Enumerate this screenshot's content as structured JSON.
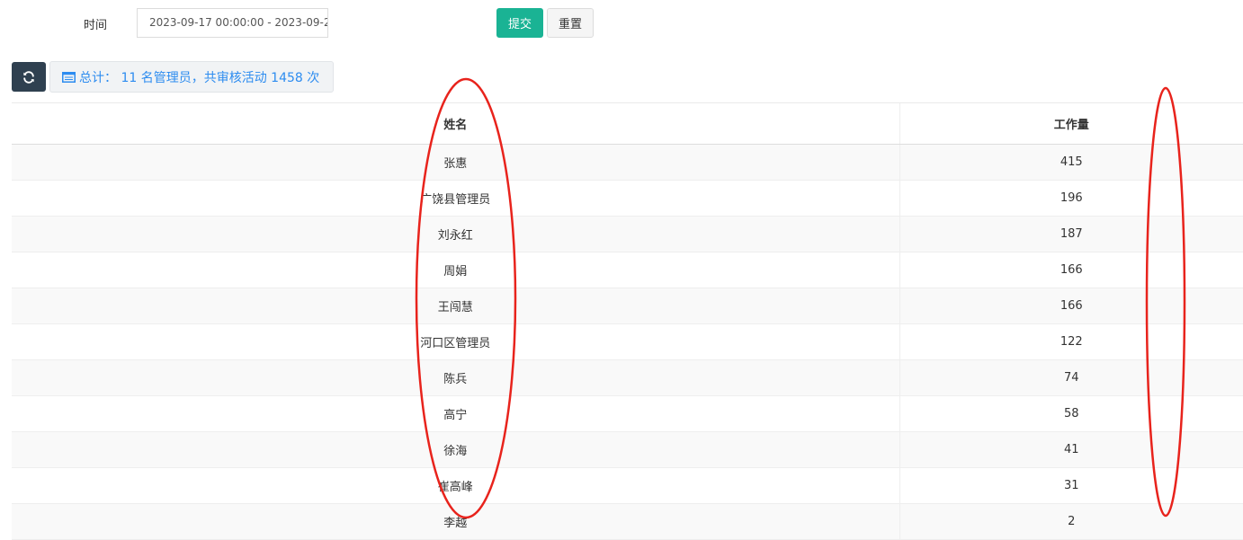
{
  "filter": {
    "time_label": "时间",
    "date_range_value": "2023-09-17 00:00:00 - 2023-09-2",
    "submit_label": "提交",
    "reset_label": "重置"
  },
  "toolbar": {
    "refresh_icon": "refresh-icon",
    "summary_icon": "list-icon",
    "summary_text": "总计： 11 名管理员，共审核活动 1458 次"
  },
  "table": {
    "columns": [
      "姓名",
      "工作量"
    ],
    "rows": [
      {
        "name": "张惠",
        "workload": "415"
      },
      {
        "name": "广饶县管理员",
        "workload": "196"
      },
      {
        "name": "刘永红",
        "workload": "187"
      },
      {
        "name": "周娟",
        "workload": "166"
      },
      {
        "name": "王闯慧",
        "workload": "166"
      },
      {
        "name": "河口区管理员",
        "workload": "122"
      },
      {
        "name": "陈兵",
        "workload": "74"
      },
      {
        "name": "高宁",
        "workload": "58"
      },
      {
        "name": "徐海",
        "workload": "41"
      },
      {
        "name": "崔高峰",
        "workload": "31"
      },
      {
        "name": "李越",
        "workload": "2"
      }
    ]
  },
  "colors": {
    "submit": "#1ab394",
    "refresh": "#2f4050",
    "summary_text": "#2d8cf0",
    "annotation_ellipse": "#e8231c"
  }
}
